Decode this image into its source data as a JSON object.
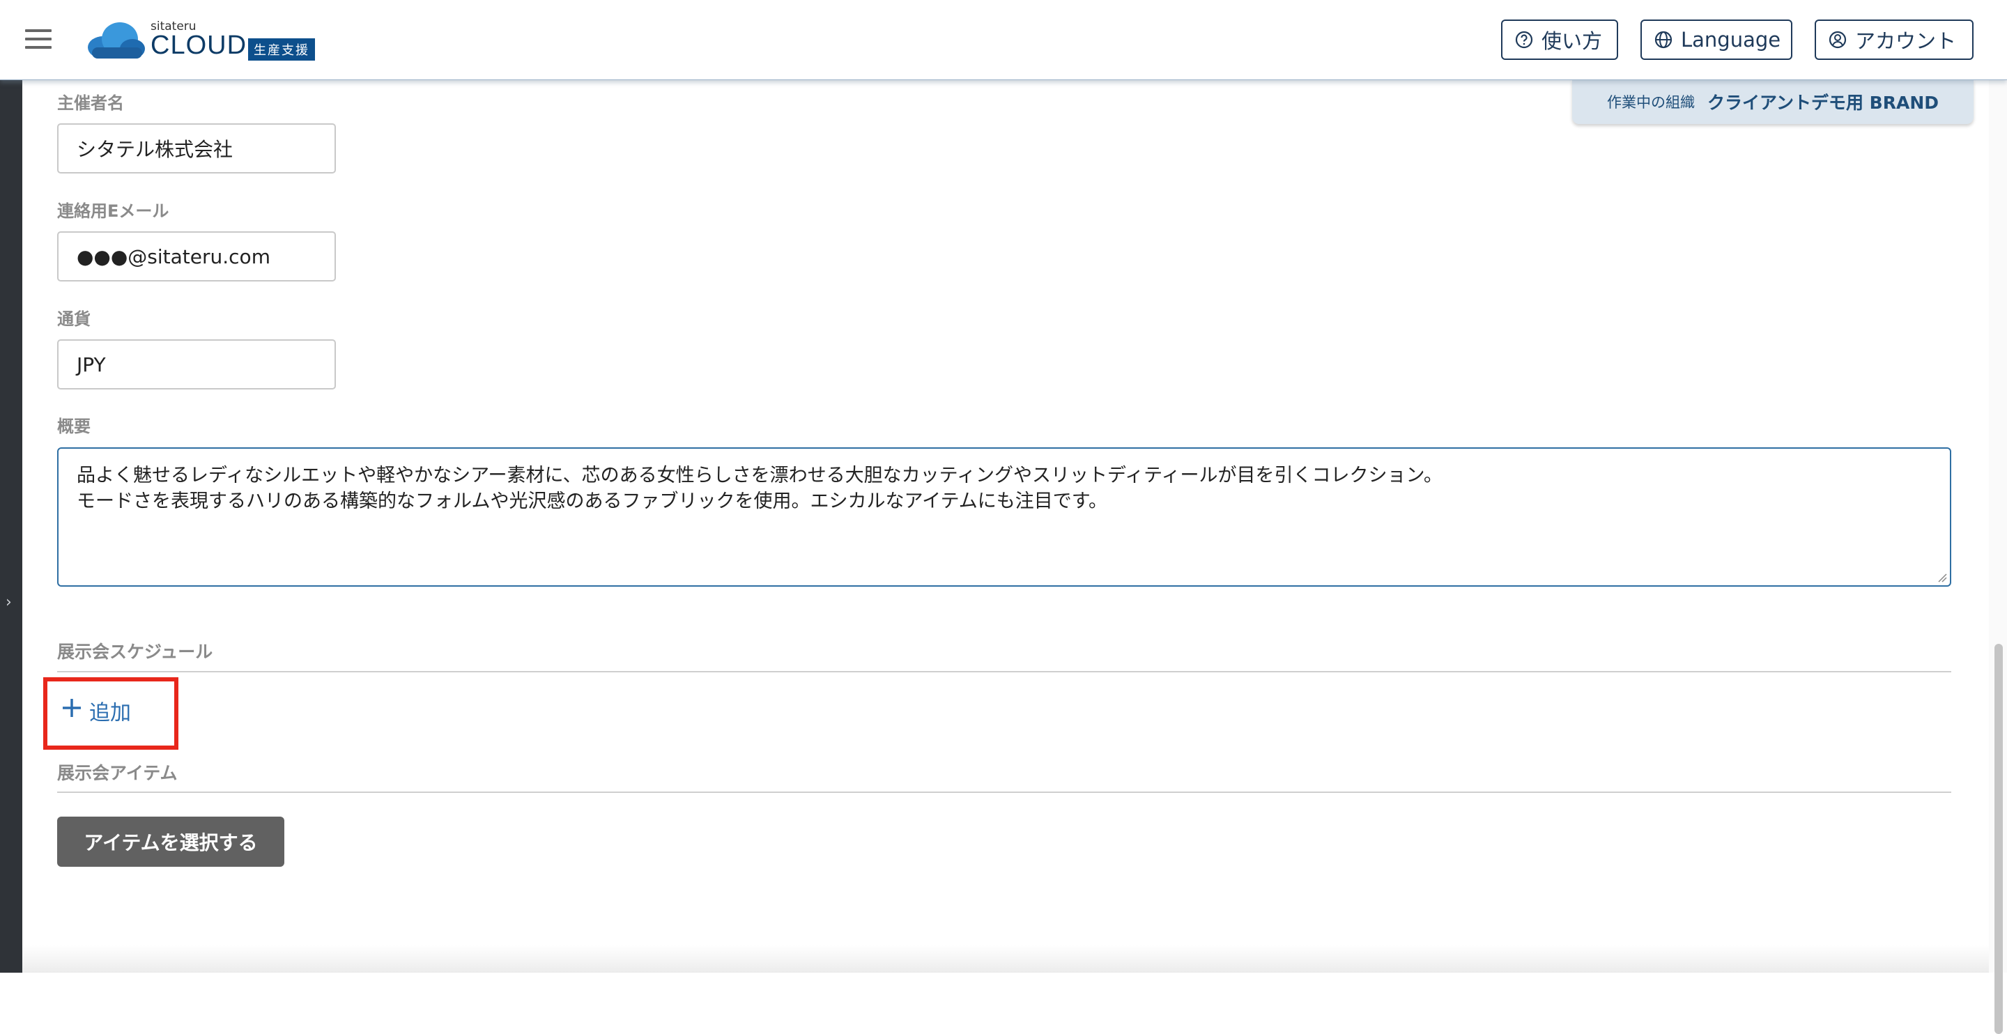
{
  "header": {
    "logo_small": "sitateru",
    "logo_main": "CLOUD",
    "logo_badge": "生産支援",
    "help_label": "使い方",
    "language_label": "Language",
    "account_label": "アカウント"
  },
  "org": {
    "label": "作業中の組織",
    "name": "クライアントデモ用 BRAND"
  },
  "form": {
    "organizer_label": "主催者名",
    "organizer_value": "シタテル株式会社",
    "email_label": "連絡用Eメール",
    "email_value": "●●●@sitateru.com",
    "currency_label": "通貨",
    "currency_value": "JPY",
    "summary_label": "概要",
    "summary_line1": "品よく魅せるレディなシルエットや軽やかなシアー素材に、芯のある女性らしさを漂わせる大胆なカッティングやスリットディティールが目を引くコレクション。",
    "summary_line2": "モードさを表現するハリのある構築的なフォルムや光沢感のあるファブリックを使用。エシカルなアイテムにも注目です。"
  },
  "schedule": {
    "title": "展示会スケジュール",
    "add_label": "追加"
  },
  "items": {
    "title": "展示会アイテム",
    "select_label": "アイテムを選択する"
  },
  "colors": {
    "accent": "#2a6db0",
    "header_text": "#1f3a5a",
    "highlight": "#e8271b",
    "dark_button": "#616161"
  }
}
